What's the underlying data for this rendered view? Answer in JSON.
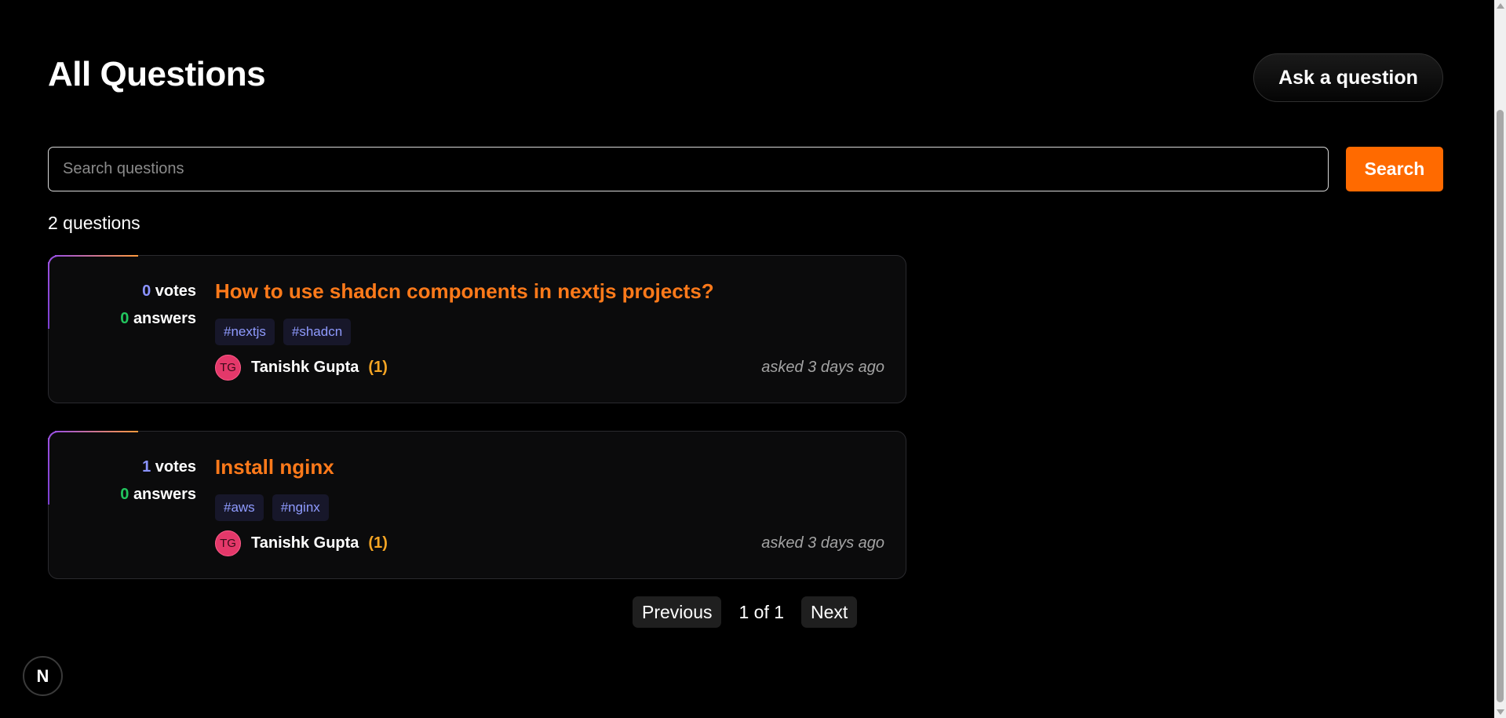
{
  "header": {
    "title": "All Questions",
    "ask_label": "Ask a question"
  },
  "search": {
    "placeholder": "Search questions",
    "value": "",
    "button_label": "Search"
  },
  "question_count": "2 questions",
  "questions": [
    {
      "votes": "0",
      "votes_label": "votes",
      "answers": "0",
      "answers_label": "answers",
      "title": "How to use shadcn components in nextjs projects?",
      "tags": [
        "#nextjs",
        "#shadcn"
      ],
      "author": {
        "initials": "TG",
        "name": "Tanishk Gupta",
        "reputation": "(1)"
      },
      "asked": "asked 3 days ago"
    },
    {
      "votes": "1",
      "votes_label": "votes",
      "answers": "0",
      "answers_label": "answers",
      "title": "Install nginx",
      "tags": [
        "#aws",
        "#nginx"
      ],
      "author": {
        "initials": "TG",
        "name": "Tanishk Gupta",
        "reputation": "(1)"
      },
      "asked": "asked 3 days ago"
    }
  ],
  "pagination": {
    "previous_label": "Previous",
    "info": "1 of 1",
    "next_label": "Next"
  },
  "nextjs_badge": {
    "icon": "nextjs-logo-icon",
    "glyph": "N"
  },
  "colors": {
    "background": "#000000",
    "accent_orange": "#ff6a00",
    "title_orange": "#ff7a1a",
    "votes_blue": "#8b93ff",
    "answers_green": "#22c55e",
    "tag_text": "#8f9bff",
    "reputation_amber": "#f5a524",
    "avatar_pink": "#e4386a"
  }
}
